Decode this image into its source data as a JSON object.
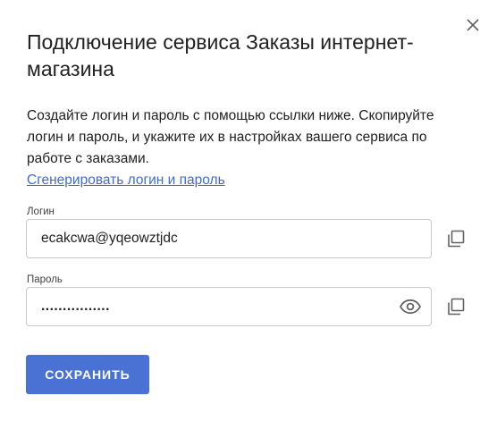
{
  "dialog": {
    "title": "Подключение сервиса Заказы интернет-магазина",
    "description": "Создайте логин и пароль с помощью ссылки ниже. Скопируйте логин и пароль, и укажите их в настройках вашего сервиса по работе с заказами.",
    "generate_link": "Сгенерировать логин и пароль",
    "close_icon": "close-icon"
  },
  "login": {
    "label": "Логин",
    "value": "ecakcwa@yqeowztjdc",
    "copy_icon": "copy-icon"
  },
  "password": {
    "label": "Пароль",
    "value": "................",
    "visibility_icon": "eye-icon",
    "copy_icon": "copy-icon"
  },
  "actions": {
    "save_label": "СОХРАНИТЬ"
  },
  "colors": {
    "accent": "#4a72d4",
    "link": "#3f6bd2",
    "icon": "#616161"
  }
}
